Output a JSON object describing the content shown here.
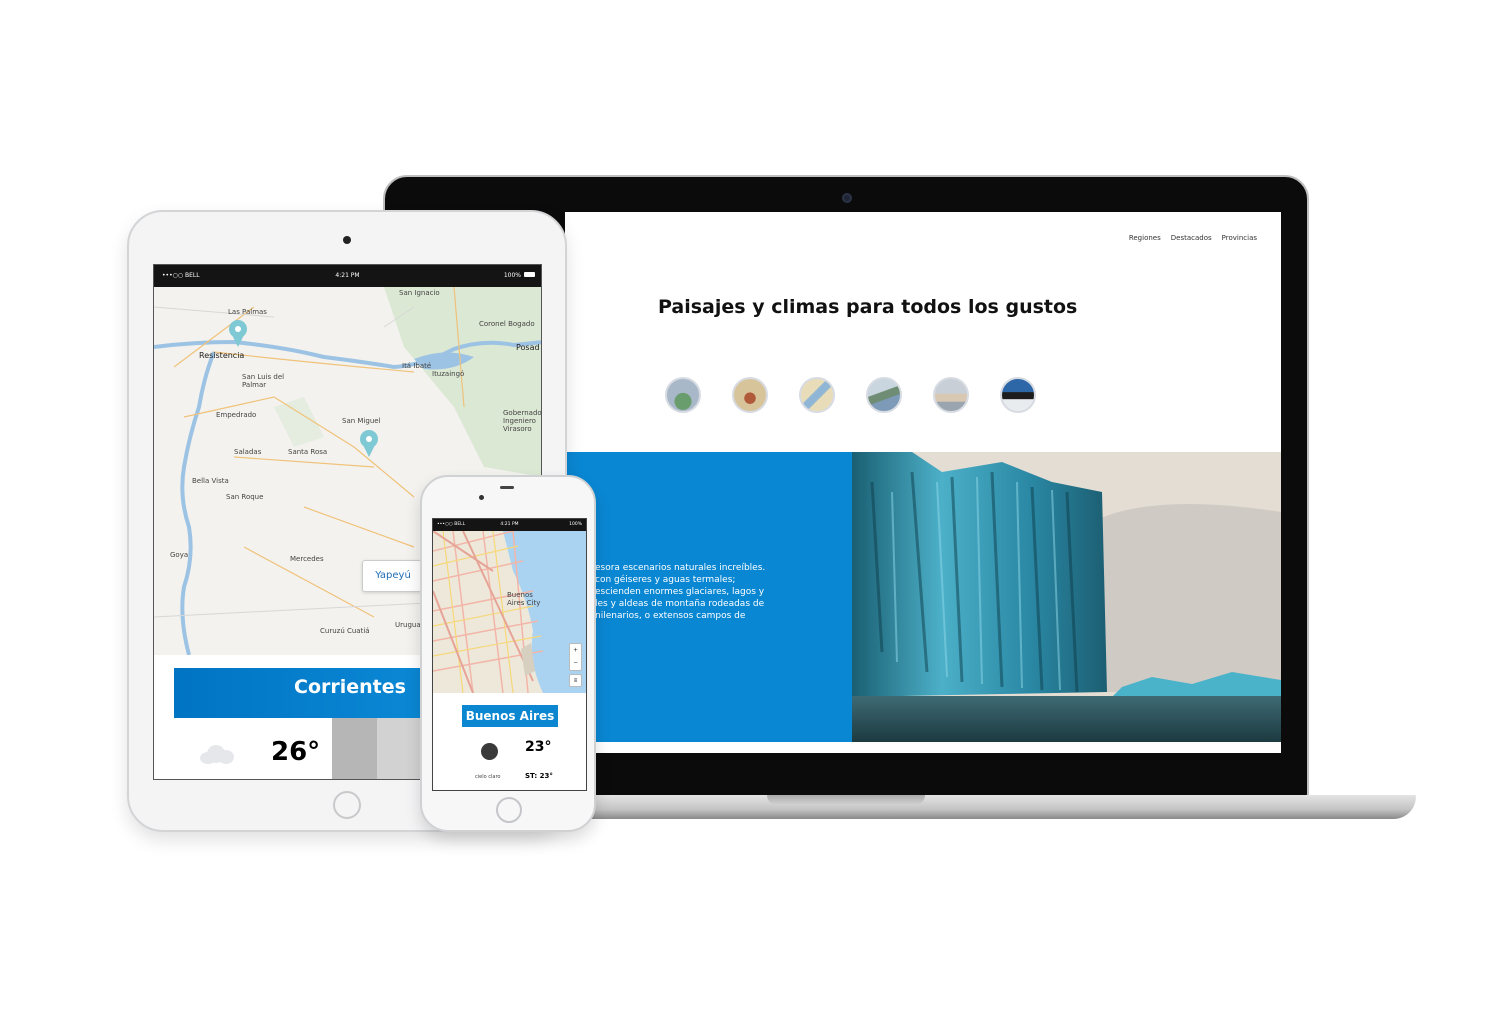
{
  "laptop": {
    "nav": [
      "Regiones",
      "Destacados",
      "Provincias"
    ],
    "heading": "Paisajes y climas para todos los gustos",
    "region_icons": [
      "region-icon-1",
      "region-icon-2",
      "region-icon-3",
      "region-icon-4",
      "region-icon-5",
      "region-icon-6"
    ],
    "body_lines": [
      "esora escenarios naturales increíbles.",
      "con géiseres y aguas termales;",
      "escienden enormes glaciares, lagos y",
      "les y aldeas de montaña rodeadas de",
      "nilenarios, o extensos campos de"
    ],
    "accent_color": "#0a87d3"
  },
  "tablet": {
    "status": {
      "carrier": "•••○○ BELL",
      "time": "4:21 PM",
      "battery": "100%"
    },
    "map_labels": [
      "San Ignacio",
      "Las Palmas",
      "Coronel Bogado",
      "Posad",
      "Resistencia",
      "Itá Ibaté",
      "Ituzaingó",
      "San Luis del Palmar",
      "Gobernador Ingeniero Virasoro",
      "Empedrado",
      "San Miguel",
      "Saladas",
      "Santa Rosa",
      "Bella Vista",
      "San Roque",
      "Goya",
      "Mercedes",
      "Curuzú Cuatiá",
      "Uruguaia"
    ],
    "popup_label": "Yapeyú",
    "province": "Corrientes",
    "temperature": "26°"
  },
  "phone": {
    "status": {
      "carrier": "•••○○ BELL",
      "time": "4:21 PM",
      "battery": "100%"
    },
    "map_label": "Buenos Aires City",
    "zoom_in": "+",
    "zoom_out": "−",
    "city": "Buenos Aires",
    "temperature": "23°",
    "condition": "cielo claro",
    "feels_like": "ST: 23°"
  }
}
